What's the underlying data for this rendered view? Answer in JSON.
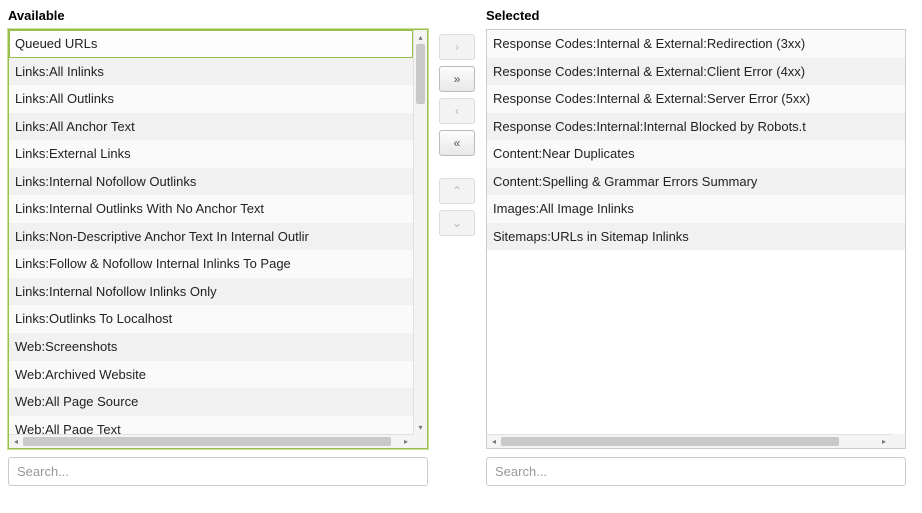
{
  "headings": {
    "available": "Available",
    "selected": "Selected"
  },
  "search": {
    "placeholder_left": "Search...",
    "placeholder_right": "Search..."
  },
  "controls": {
    "move_right": ">",
    "move_all_right": "»",
    "move_left": "<",
    "move_all_left": "«",
    "move_up": "^",
    "move_down": "v"
  },
  "available_items": [
    "Queued URLs",
    "Links:All Inlinks",
    "Links:All Outlinks",
    "Links:All Anchor Text",
    "Links:External Links",
    "Links:Internal Nofollow Outlinks",
    "Links:Internal Outlinks With No Anchor Text",
    "Links:Non-Descriptive Anchor Text In Internal Outlir",
    "Links:Follow & Nofollow Internal Inlinks To Page",
    "Links:Internal Nofollow Inlinks Only",
    "Links:Outlinks To Localhost",
    "Web:Screenshots",
    "Web:Archived Website",
    "Web:All Page Source",
    "Web:All Page Text"
  ],
  "selected_items": [
    "Response Codes:Internal & External:Redirection (3xx)",
    "Response Codes:Internal & External:Client Error (4xx)",
    "Response Codes:Internal & External:Server Error (5xx)",
    "Response Codes:Internal:Internal Blocked by Robots.t",
    "Content:Near Duplicates",
    "Content:Spelling & Grammar Errors Summary",
    "Images:All Image Inlinks",
    "Sitemaps:URLs in Sitemap Inlinks"
  ]
}
